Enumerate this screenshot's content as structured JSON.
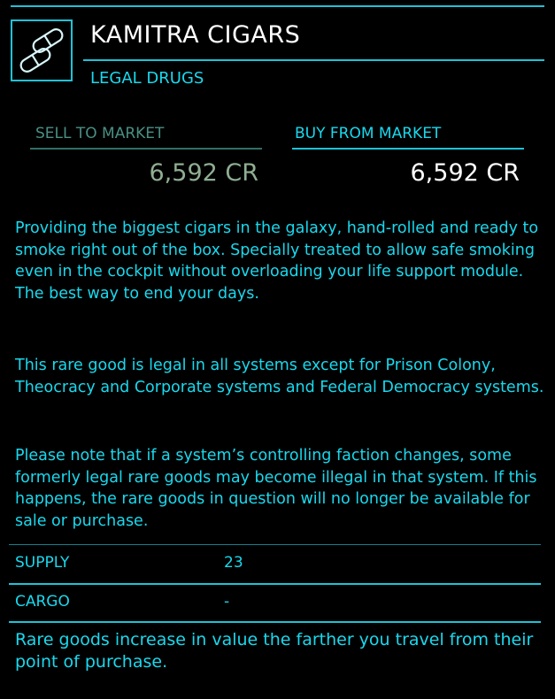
{
  "commodity": {
    "icon": "pills-icon",
    "name": "KAMITRA CIGARS",
    "category": "LEGAL DRUGS"
  },
  "market": {
    "sell_label": "SELL TO MARKET",
    "sell_price": "6,592 CR",
    "buy_label": "BUY FROM MARKET",
    "buy_price": "6,592 CR"
  },
  "description": [
    "Providing the biggest cigars in the galaxy, hand-rolled and ready to smoke right out of the box. Specially treated to allow safe smoking even in the cockpit without overloading your life support module. The best way to end your days.",
    "This rare good is legal in all systems except for Prison Colony, Theocracy and Corporate systems and Federal Democracy systems.",
    "Please note that if a system’s controlling faction changes, some formerly legal rare goods may become illegal in that system. If this happens, the rare goods in question will no longer be available for sale or purchase."
  ],
  "stats": {
    "supply_label": "SUPPLY",
    "supply_value": "23",
    "cargo_label": "CARGO",
    "cargo_value": "-"
  },
  "footer": "Rare goods increase in value the farther you travel from their point of purchase.",
  "colors": {
    "accent": "#19d9ee",
    "title": "#ffffff",
    "muted": "#4a8f84",
    "background": "#000000"
  }
}
